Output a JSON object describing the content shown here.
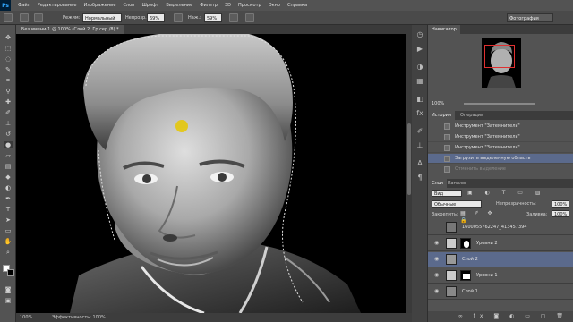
{
  "app": {
    "logo": "Ps"
  },
  "menu": [
    "Файл",
    "Редактирование",
    "Изображение",
    "Слои",
    "Шрифт",
    "Выделение",
    "Фильтр",
    "3D",
    "Просмотр",
    "Окно",
    "Справка"
  ],
  "options": {
    "mode_label": "Режим:",
    "mode_value": "Нормальный",
    "opacity_label": "Непрозр.:",
    "opacity_value": "69%",
    "pressure_label": "Наж.:",
    "pressure_value": "59%",
    "workspace": "Фотография"
  },
  "document": {
    "tab_title": "Без имени-1 @ 100% (Слой 2, Гр.сер./8) *"
  },
  "status": {
    "zoom": "100%",
    "info": "Эффективность: 100%"
  },
  "navigator": {
    "tab": "Навигатор",
    "zoom": "100%"
  },
  "history": {
    "tabs": [
      "История",
      "Операции"
    ],
    "items": [
      "Инструмент \"Затемнитель\"",
      "Инструмент \"Затемнитель\"",
      "Инструмент \"Затемнитель\"",
      "Загрузить выделенную область",
      "Отменить выделение"
    ]
  },
  "layers": {
    "tabs": [
      "Слои",
      "Каналы"
    ],
    "filter_label": "Вид",
    "blend_mode": "Обычные",
    "opacity_label": "Непрозрачность:",
    "opacity_value": "100%",
    "lock_label": "Закрепить:",
    "fill_label": "Заливка:",
    "fill_value": "100%",
    "rows": [
      {
        "name": "1600055762247_413457394"
      },
      {
        "name": "Уровни 2"
      },
      {
        "name": "Слой 2"
      },
      {
        "name": "Уровни 1"
      },
      {
        "name": "Слой 1"
      }
    ]
  },
  "colors": {
    "brush_cursor": "#e6c700",
    "selected": "#5b6a8c"
  }
}
